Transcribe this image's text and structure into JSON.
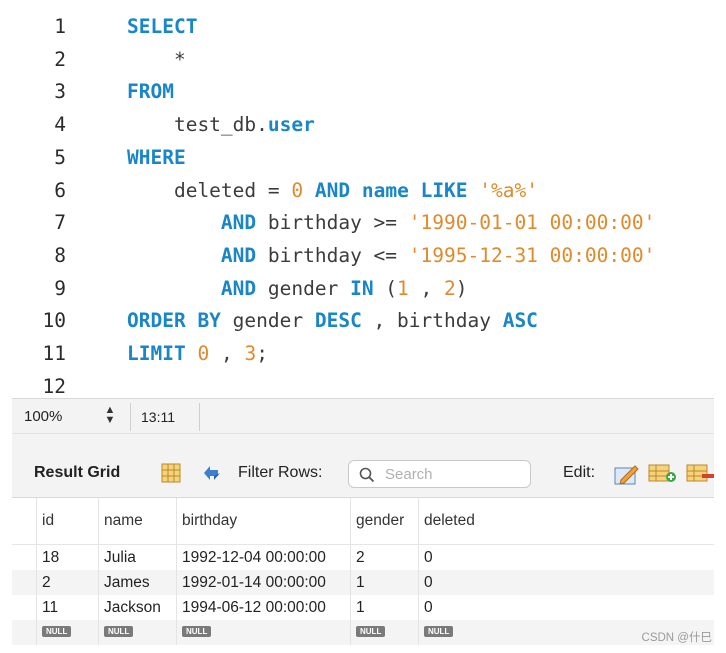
{
  "editor": {
    "lines": [
      {
        "n": "1",
        "tokens": [
          {
            "t": "SELECT",
            "c": "kw"
          }
        ]
      },
      {
        "n": "2",
        "tokens": [
          {
            "t": "    *",
            "c": "op"
          }
        ]
      },
      {
        "n": "3",
        "tokens": [
          {
            "t": "FROM",
            "c": "kw"
          }
        ]
      },
      {
        "n": "4",
        "tokens": [
          {
            "t": "    test_db.",
            "c": "ident"
          },
          {
            "t": "user",
            "c": "fn"
          }
        ]
      },
      {
        "n": "5",
        "tokens": [
          {
            "t": "WHERE",
            "c": "kw"
          }
        ]
      },
      {
        "n": "6",
        "tokens": [
          {
            "t": "    deleted = ",
            "c": "ident"
          },
          {
            "t": "0",
            "c": "num"
          },
          {
            "t": " ",
            "c": "op"
          },
          {
            "t": "AND",
            "c": "kw"
          },
          {
            "t": " ",
            "c": "op"
          },
          {
            "t": "name",
            "c": "fn"
          },
          {
            "t": " ",
            "c": "op"
          },
          {
            "t": "LIKE",
            "c": "kw"
          },
          {
            "t": " ",
            "c": "op"
          },
          {
            "t": "'%a%'",
            "c": "str"
          }
        ]
      },
      {
        "n": "7",
        "tokens": [
          {
            "t": "        ",
            "c": "op"
          },
          {
            "t": "AND",
            "c": "kw"
          },
          {
            "t": " birthday >= ",
            "c": "ident"
          },
          {
            "t": "'1990-01-01 00:00:00'",
            "c": "str"
          }
        ]
      },
      {
        "n": "8",
        "tokens": [
          {
            "t": "        ",
            "c": "op"
          },
          {
            "t": "AND",
            "c": "kw"
          },
          {
            "t": " birthday <= ",
            "c": "ident"
          },
          {
            "t": "'1995-12-31 00:00:00'",
            "c": "str"
          }
        ]
      },
      {
        "n": "9",
        "tokens": [
          {
            "t": "        ",
            "c": "op"
          },
          {
            "t": "AND",
            "c": "kw"
          },
          {
            "t": " gender ",
            "c": "ident"
          },
          {
            "t": "IN",
            "c": "kw"
          },
          {
            "t": " (",
            "c": "op"
          },
          {
            "t": "1",
            "c": "num"
          },
          {
            "t": " , ",
            "c": "op"
          },
          {
            "t": "2",
            "c": "num"
          },
          {
            "t": ")",
            "c": "op"
          }
        ]
      },
      {
        "n": "10",
        "tokens": [
          {
            "t": "ORDER BY",
            "c": "kw"
          },
          {
            "t": " gender ",
            "c": "ident"
          },
          {
            "t": "DESC",
            "c": "kw"
          },
          {
            "t": " , birthday ",
            "c": "ident"
          },
          {
            "t": "ASC",
            "c": "kw"
          }
        ]
      },
      {
        "n": "11",
        "tokens": [
          {
            "t": "LIMIT",
            "c": "kw"
          },
          {
            "t": " ",
            "c": "op"
          },
          {
            "t": "0",
            "c": "num"
          },
          {
            "t": " , ",
            "c": "op"
          },
          {
            "t": "3",
            "c": "num"
          },
          {
            "t": ";",
            "c": "op"
          }
        ]
      },
      {
        "n": "12",
        "tokens": []
      }
    ]
  },
  "statusbar": {
    "zoom": "100%",
    "cursor": "13:11"
  },
  "result_toolbar": {
    "label": "Result Grid",
    "filter_label": "Filter Rows:",
    "search_placeholder": "Search",
    "edit_label": "Edit:"
  },
  "grid": {
    "columns": [
      "id",
      "name",
      "birthday",
      "gender",
      "deleted"
    ],
    "rows": [
      [
        "18",
        "Julia",
        "1992-12-04 00:00:00",
        "2",
        "0"
      ],
      [
        "2",
        "James",
        "1992-01-14 00:00:00",
        "1",
        "0"
      ],
      [
        "11",
        "Jackson",
        "1994-06-12 00:00:00",
        "1",
        "0"
      ],
      [
        "NULL",
        "NULL",
        "NULL",
        "NULL",
        "NULL"
      ]
    ]
  },
  "watermark": "CSDN @什巳",
  "colors": {
    "keyword": "#1a86c8",
    "literal": "#e08a2b",
    "text": "#3c3c3c"
  }
}
